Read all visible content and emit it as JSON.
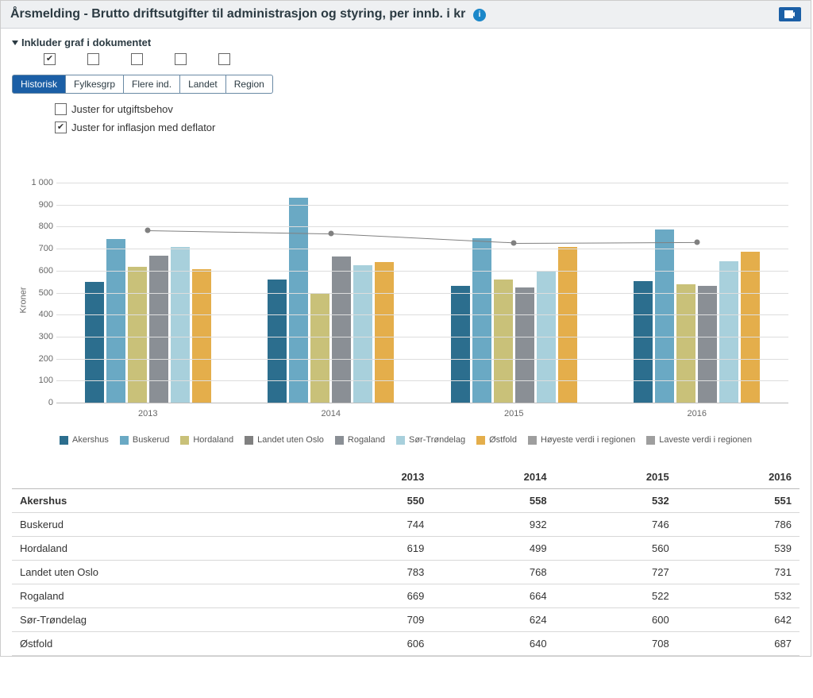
{
  "header": {
    "title": "Årsmelding - Brutto driftsutgifter til administrasjon og styring, per innb. i kr",
    "info_tooltip": "i"
  },
  "disclosure_label": "Inkluder graf i dokumentet",
  "include_checks": [
    true,
    false,
    false,
    false,
    false
  ],
  "tabs": [
    {
      "label": "Historisk",
      "active": true
    },
    {
      "label": "Fylkesgrp",
      "active": false
    },
    {
      "label": "Flere ind.",
      "active": false
    },
    {
      "label": "Landet",
      "active": false
    },
    {
      "label": "Region",
      "active": false
    }
  ],
  "options": [
    {
      "label": "Juster for utgiftsbehov",
      "checked": false
    },
    {
      "label": "Juster for inflasjon med deflator",
      "checked": true
    }
  ],
  "chart_data": {
    "type": "bar",
    "ylabel": "Kroner",
    "ylim": [
      0,
      1000
    ],
    "yticks": [
      0,
      100,
      200,
      300,
      400,
      500,
      600,
      700,
      800,
      900,
      1000
    ],
    "categories": [
      "2013",
      "2014",
      "2015",
      "2016"
    ],
    "series": [
      {
        "name": "Akershus",
        "color": "#2c6e8e",
        "values": [
          550,
          558,
          532,
          551
        ]
      },
      {
        "name": "Buskerud",
        "color": "#6aa9c4",
        "values": [
          744,
          932,
          746,
          786
        ]
      },
      {
        "name": "Hordaland",
        "color": "#c9c179",
        "values": [
          619,
          499,
          560,
          539
        ]
      },
      {
        "name": "Landet uten Oslo",
        "color": "#808080",
        "values": [
          783,
          768,
          727,
          731
        ],
        "line": true
      },
      {
        "name": "Rogaland",
        "color": "#8a8f95",
        "values": [
          669,
          664,
          522,
          532
        ]
      },
      {
        "name": "Sør-Trøndelag",
        "color": "#a8d0dc",
        "values": [
          709,
          624,
          600,
          642
        ]
      },
      {
        "name": "Østfold",
        "color": "#e4ae4b",
        "values": [
          606,
          640,
          708,
          687
        ]
      },
      {
        "name": "Høyeste verdi i regionen",
        "color": "#9e9e9e",
        "legend_only": true
      },
      {
        "name": "Laveste verdi i regionen",
        "color": "#9e9e9e",
        "legend_only": true
      }
    ]
  },
  "table": {
    "columns": [
      "",
      "2013",
      "2014",
      "2015",
      "2016"
    ],
    "rows": [
      {
        "label": "Akershus",
        "values": [
          550,
          558,
          532,
          551
        ],
        "bold": true
      },
      {
        "label": "Buskerud",
        "values": [
          744,
          932,
          746,
          786
        ]
      },
      {
        "label": "Hordaland",
        "values": [
          619,
          499,
          560,
          539
        ]
      },
      {
        "label": "Landet uten Oslo",
        "values": [
          783,
          768,
          727,
          731
        ]
      },
      {
        "label": "Rogaland",
        "values": [
          669,
          664,
          522,
          532
        ]
      },
      {
        "label": "Sør-Trøndelag",
        "values": [
          709,
          624,
          600,
          642
        ]
      },
      {
        "label": "Østfold",
        "values": [
          606,
          640,
          708,
          687
        ]
      }
    ]
  }
}
